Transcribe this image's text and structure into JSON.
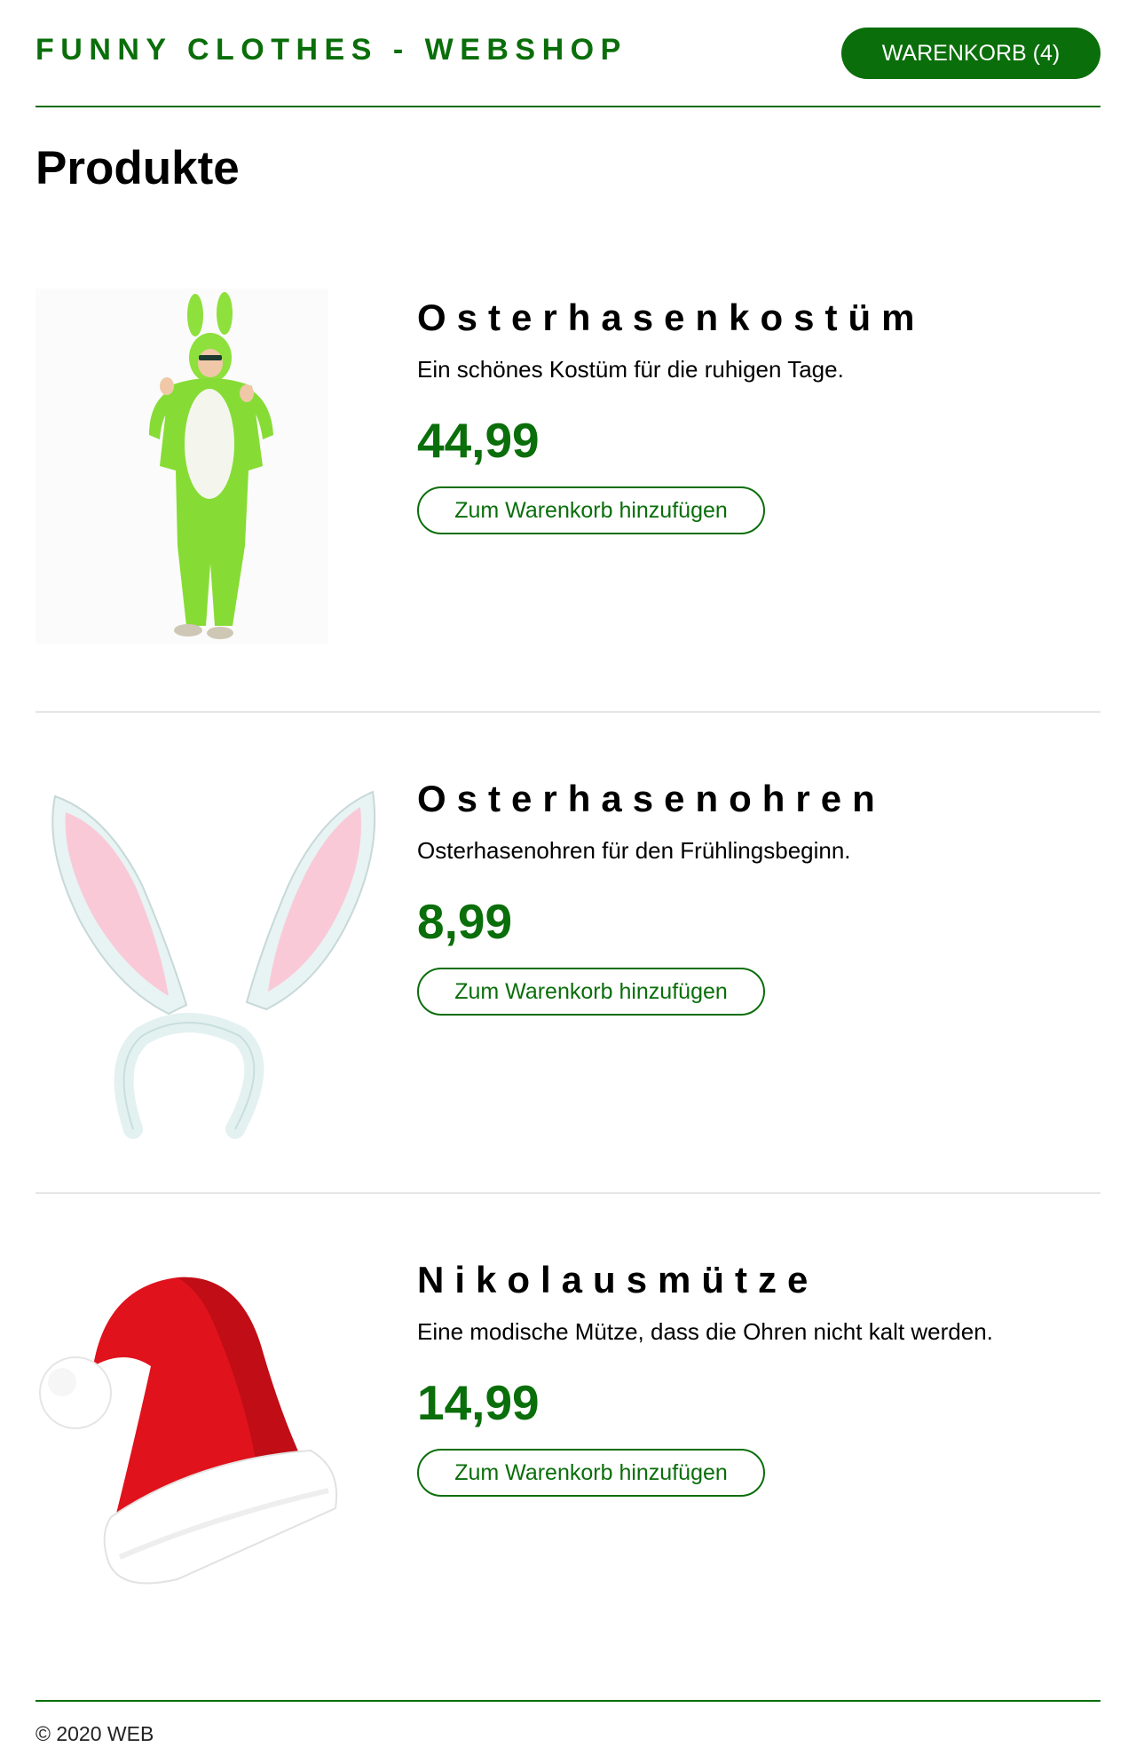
{
  "header": {
    "brand": "FUNNY CLOTHES - WEBSHOP",
    "cart_button": "WARENKORB (4)"
  },
  "page_title": "Produkte",
  "products": [
    {
      "name": "Osterhasenkostüm",
      "description": "Ein schönes Kostüm für die ruhigen Tage.",
      "price": "44,99",
      "add_button": "Zum Warenkorb hinzufügen",
      "image_icon": "green-bunny-costume-image"
    },
    {
      "name": "Osterhasenohren",
      "description": "Osterhasenohren für den Frühlingsbeginn.",
      "price": "8,99",
      "add_button": "Zum Warenkorb hinzufügen",
      "image_icon": "bunny-ears-headband-image"
    },
    {
      "name": "Nikolausmütze",
      "description": "Eine modische Mütze, dass die Ohren nicht kalt werden.",
      "price": "14,99",
      "add_button": "Zum Warenkorb hinzufügen",
      "image_icon": "santa-hat-image"
    }
  ],
  "footer": "© 2020 WEB",
  "colors": {
    "brand_green": "#0a6e0a",
    "row_divider": "#e6e6e6"
  }
}
